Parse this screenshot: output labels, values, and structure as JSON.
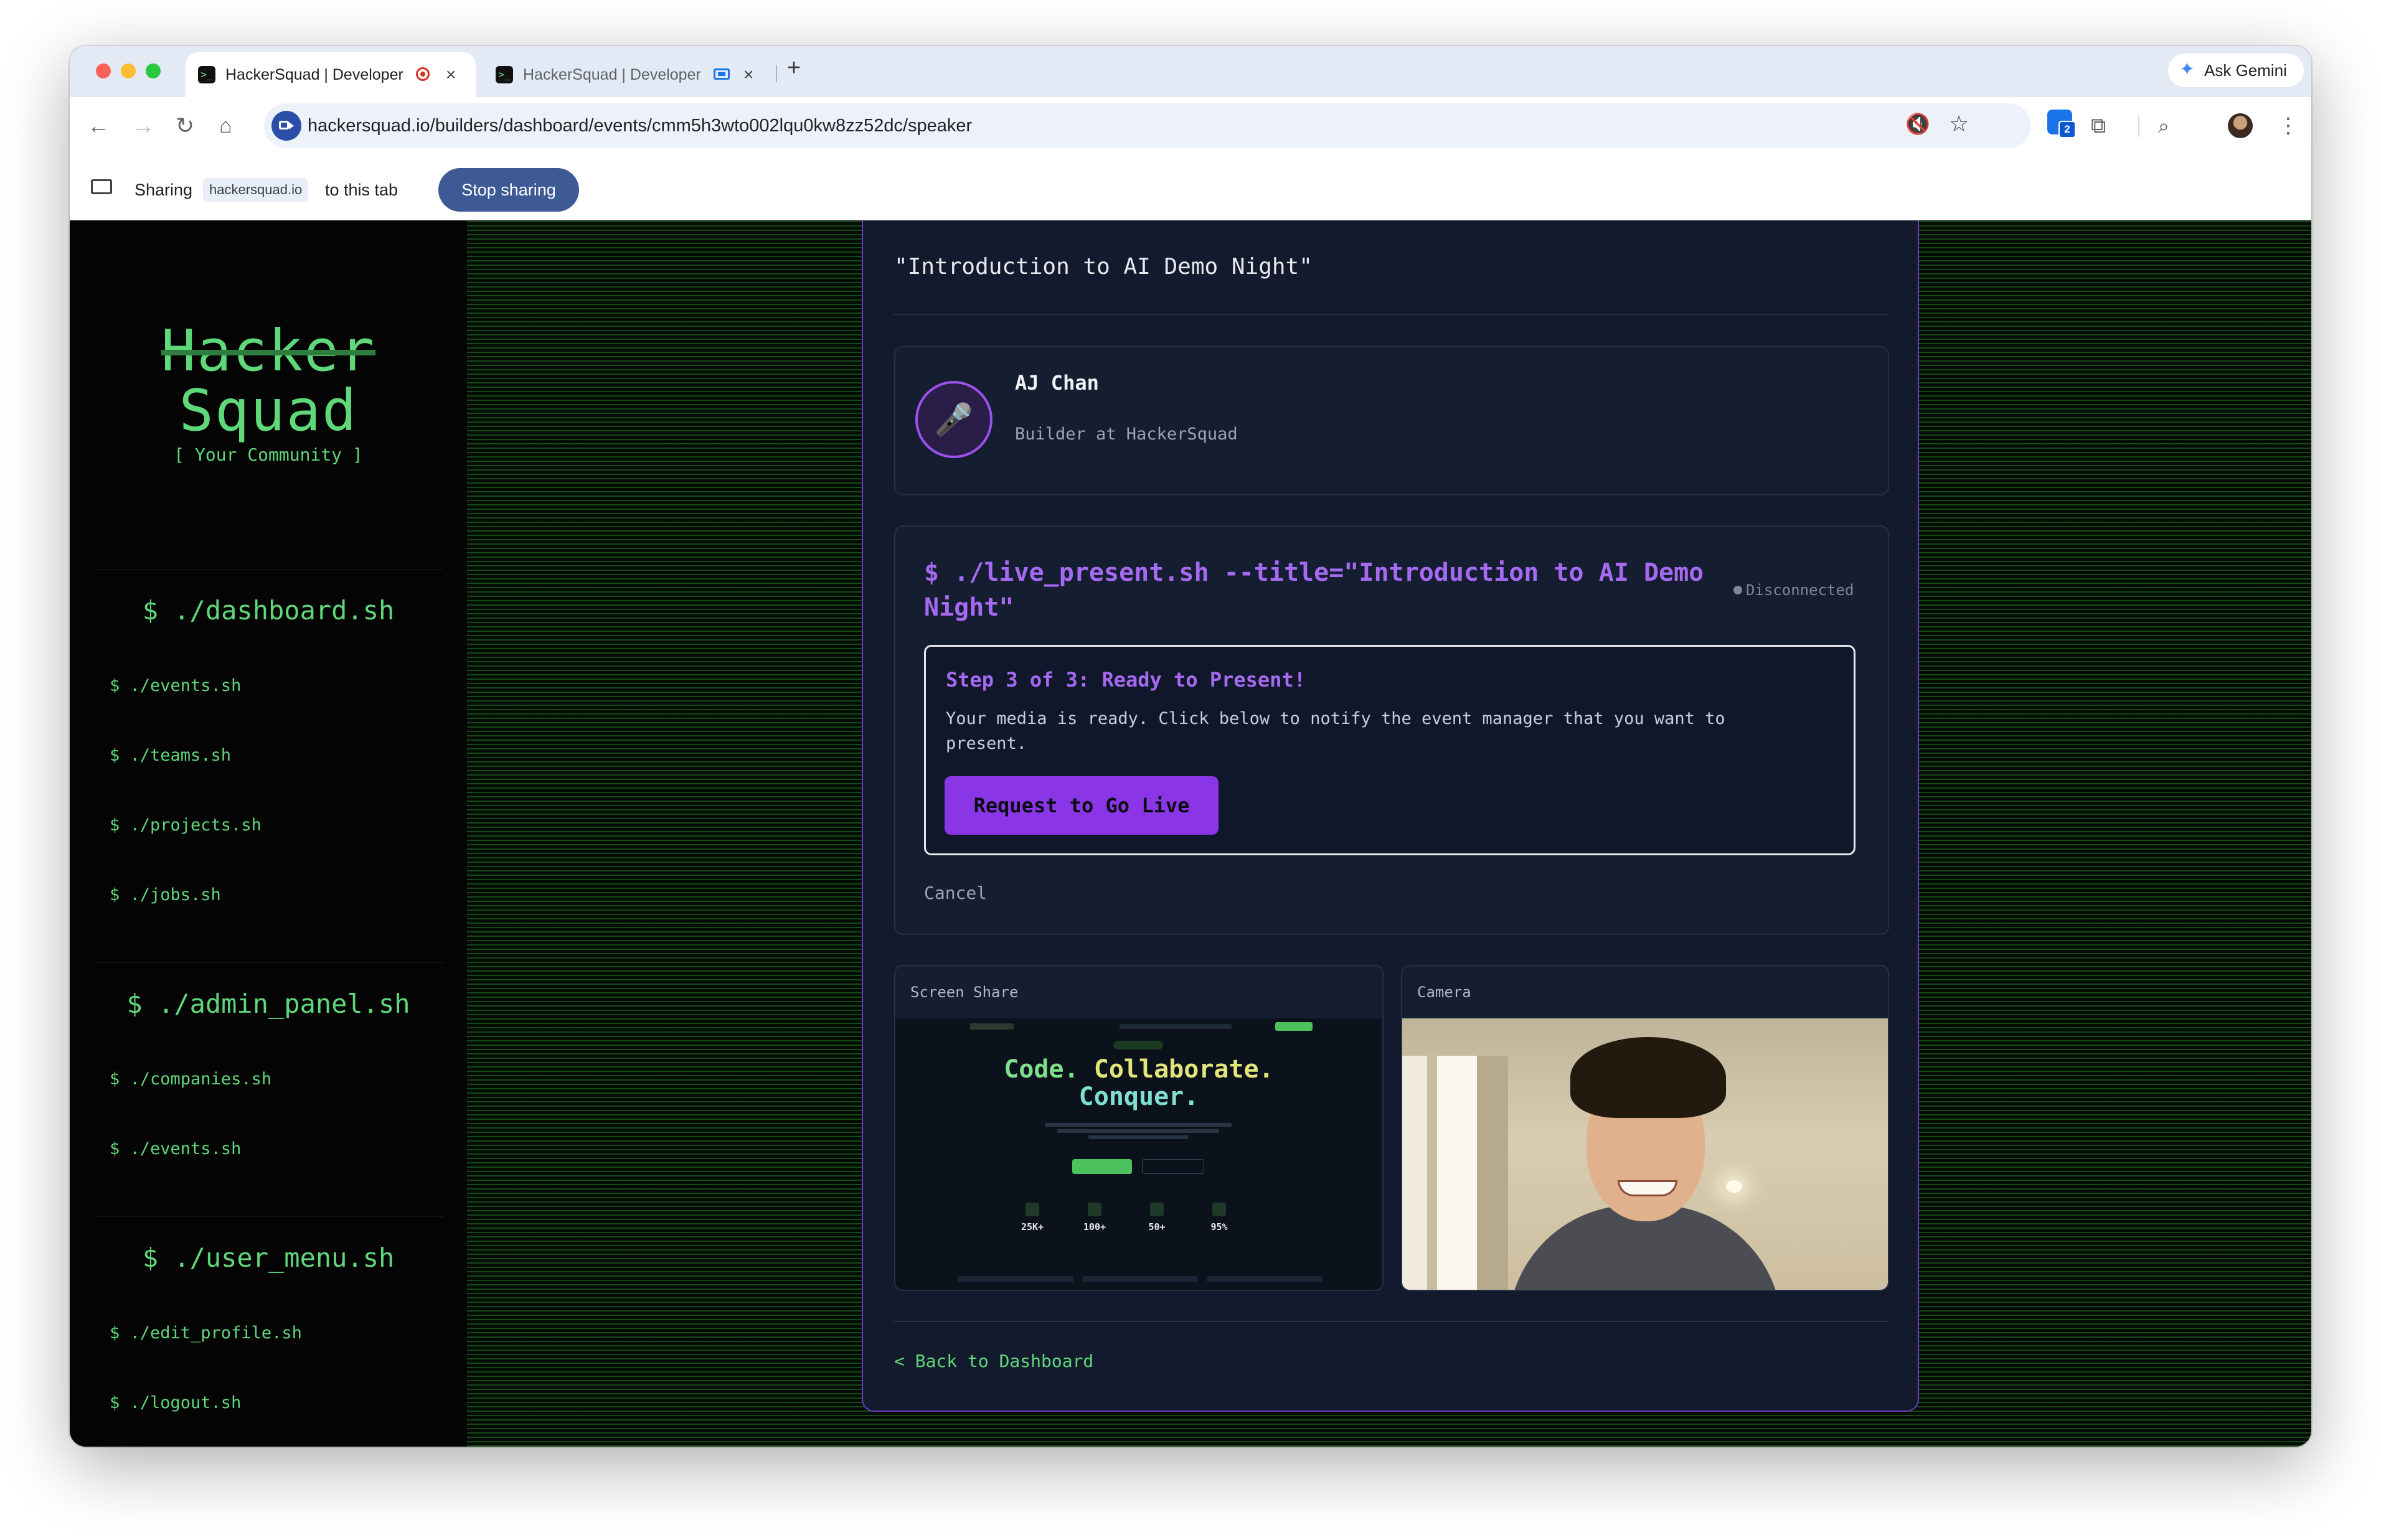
{
  "browser": {
    "tabs": [
      {
        "title": "HackerSquad | Developer",
        "indicator": "recording-icon"
      },
      {
        "title": "HackerSquad | Developer",
        "indicator": "screen-share-icon"
      }
    ],
    "new_tab": "+",
    "ask_gemini": "Ask Gemini",
    "url": "hackersquad.io/builders/dashboard/events/cmm5h3wto002lqu0kw8zz52dc/speaker",
    "extension_badge": "2",
    "share_bar": {
      "sharing": "Sharing",
      "domain": "hackersquad.io",
      "to_this_tab": "to this tab",
      "stop_button": "Stop sharing"
    }
  },
  "sidebar": {
    "logo_line1": "Hacker",
    "logo_line2": "Squad",
    "tagline": "[ Your Community ]",
    "sections": [
      {
        "heading": "$ ./dashboard.sh",
        "items": [
          "$ ./events.sh",
          "$ ./teams.sh",
          "$ ./projects.sh",
          "$ ./jobs.sh"
        ]
      },
      {
        "heading": "$ ./admin_panel.sh",
        "items": [
          "$ ./companies.sh",
          "$ ./events.sh"
        ]
      },
      {
        "heading": "$ ./user_menu.sh",
        "items": [
          "$ ./edit_profile.sh",
          "$ ./logout.sh"
        ]
      }
    ]
  },
  "main": {
    "event_title": "\"Introduction to AI Demo Night\"",
    "speaker": {
      "name": "AJ Chan",
      "role": "Builder at HackerSquad",
      "icon": "microphone-icon"
    },
    "live": {
      "command_line1": "$ ./live_present.sh --title=\"Introduction to AI Demo",
      "command_line2": "Night\"",
      "status": "Disconnected",
      "step_title": "Step 3 of 3: Ready to Present!",
      "step_text_line1": "Your media is ready. Click below to notify the event manager that you want to",
      "step_text_line2": "present.",
      "request_button": "Request to Go Live",
      "cancel": "Cancel"
    },
    "screen_share": {
      "label": "Screen Share",
      "preview": {
        "headline_line1_a": "Code.",
        "headline_line1_b": "Collaborate.",
        "headline_line2": "Conquer.",
        "stats": [
          "25K+",
          "100+",
          "50+",
          "95%"
        ]
      }
    },
    "camera": {
      "label": "Camera"
    },
    "back_link": "< Back to Dashboard"
  }
}
